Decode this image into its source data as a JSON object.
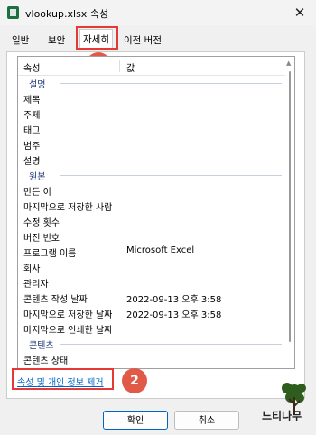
{
  "window": {
    "title": "vlookup.xlsx 속성",
    "close_glyph": "✕"
  },
  "tabs": [
    {
      "label": "일반"
    },
    {
      "label": "보안"
    },
    {
      "label": "자세히"
    },
    {
      "label": "이전 버전"
    }
  ],
  "badges": {
    "first": "1",
    "second": "2"
  },
  "list": {
    "col_property": "속성",
    "col_value": "값",
    "rows": [
      {
        "type": "group",
        "name": "설명"
      },
      {
        "type": "item",
        "name": "제목",
        "value": ""
      },
      {
        "type": "item",
        "name": "주제",
        "value": ""
      },
      {
        "type": "item",
        "name": "태그",
        "value": ""
      },
      {
        "type": "item",
        "name": "범주",
        "value": ""
      },
      {
        "type": "item",
        "name": "설명",
        "value": ""
      },
      {
        "type": "group",
        "name": "원본"
      },
      {
        "type": "item",
        "name": "만든 이",
        "value": ""
      },
      {
        "type": "item",
        "name": "마지막으로 저장한 사람",
        "value": ""
      },
      {
        "type": "item",
        "name": "수정 횟수",
        "value": ""
      },
      {
        "type": "item",
        "name": "버전 번호",
        "value": ""
      },
      {
        "type": "item",
        "name": "프로그램 이름",
        "value": "Microsoft Excel"
      },
      {
        "type": "item",
        "name": "회사",
        "value": ""
      },
      {
        "type": "item",
        "name": "관리자",
        "value": ""
      },
      {
        "type": "item",
        "name": "콘텐츠 작성 날짜",
        "value": "2022-09-13 오후 3:58"
      },
      {
        "type": "item",
        "name": "마지막으로 저장한 날짜",
        "value": "2022-09-13 오후 3:58"
      },
      {
        "type": "item",
        "name": "마지막으로 인쇄한 날짜",
        "value": ""
      },
      {
        "type": "group",
        "name": "콘텐츠"
      },
      {
        "type": "item",
        "name": "콘텐츠 상태",
        "value": ""
      }
    ]
  },
  "remove_link": "속성 및 개인 정보 제거",
  "buttons": {
    "ok": "확인",
    "cancel": "취소"
  },
  "watermark": {
    "text": "느티나무"
  },
  "colors": {
    "accent": "#0067c0",
    "highlight": "#e53935",
    "badge": "#e05a47"
  }
}
